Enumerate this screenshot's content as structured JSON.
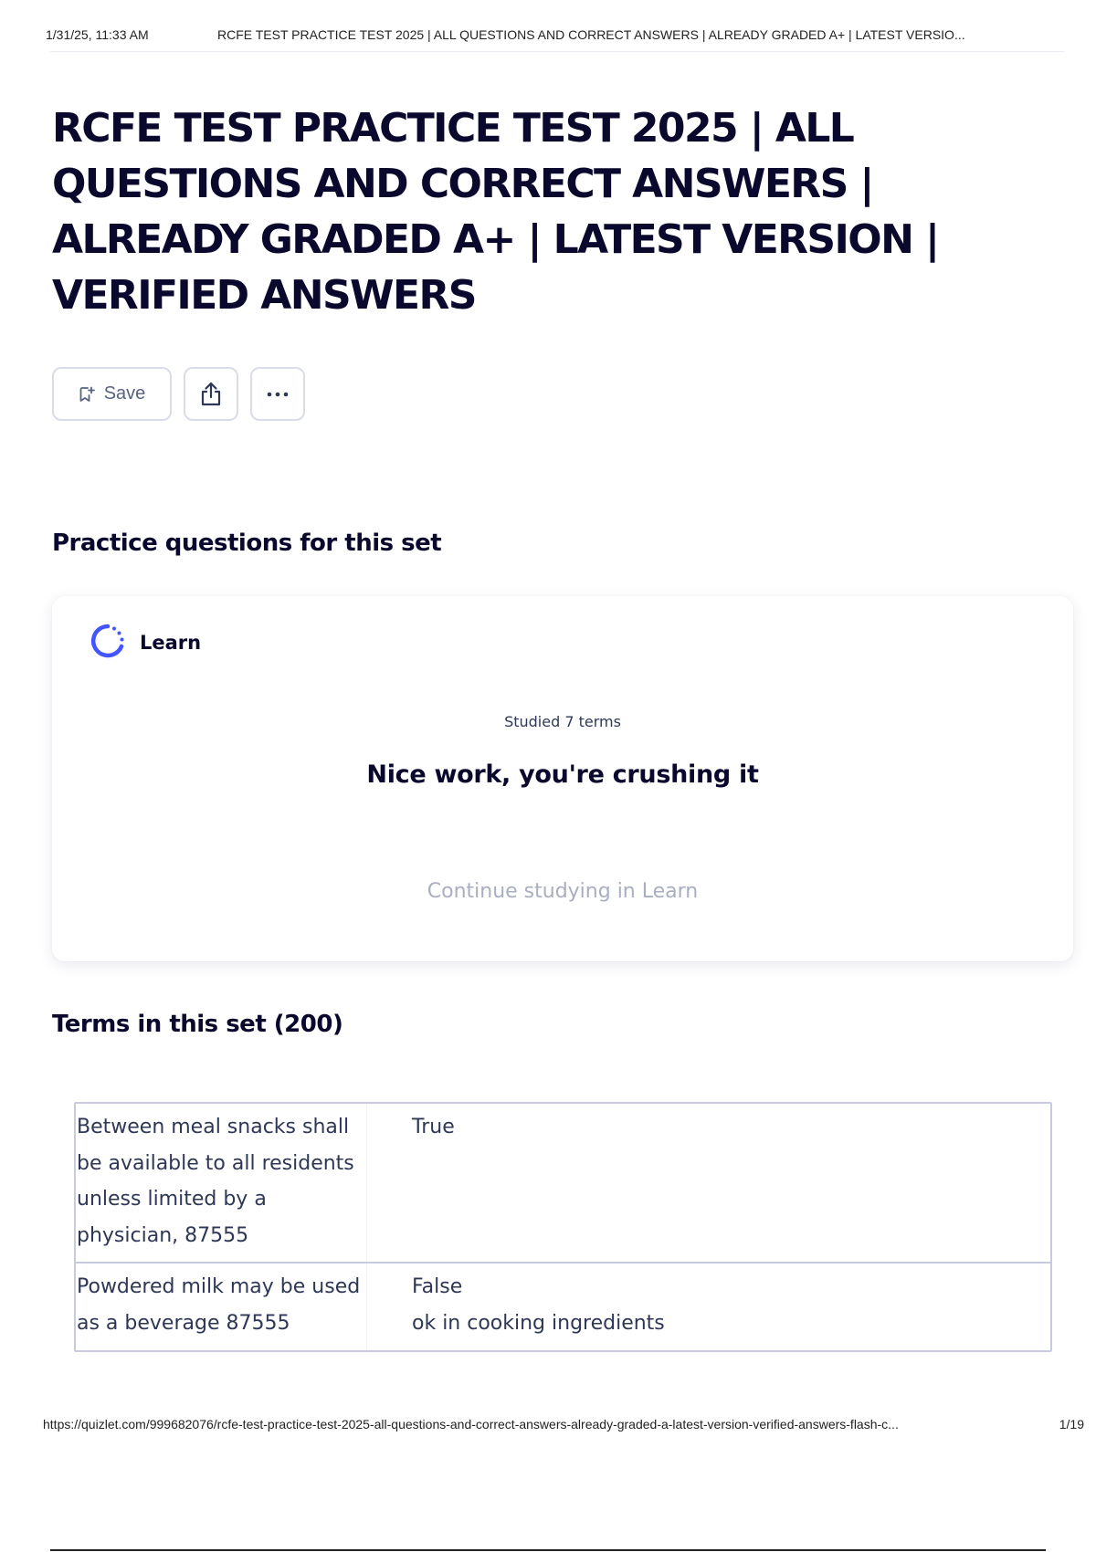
{
  "print_header": {
    "date": "1/31/25, 11:33 AM",
    "title": "RCFE TEST PRACTICE TEST 2025 | ALL QUESTIONS AND CORRECT ANSWERS | ALREADY GRADED A+ | LATEST VERSIO..."
  },
  "page": {
    "title": "RCFE TEST PRACTICE TEST 2025 | ALL QUESTIONS AND CORRECT ANSWERS | ALREADY GRADED A+ | LATEST VERSION | VERIFIED ANSWERS"
  },
  "actions": {
    "save_label": "Save",
    "save_icon": "bookmark-plus-icon",
    "share_icon": "share-icon",
    "more_icon": "more-horizontal-icon"
  },
  "practice": {
    "heading": "Practice questions for this set",
    "mode_icon": "learn-progress-icon",
    "mode_label": "Learn",
    "studied": "Studied 7 terms",
    "message": "Nice work, you're crushing it",
    "continue_label": "Continue studying in Learn"
  },
  "terms": {
    "heading": "Terms in this set (200)",
    "rows": [
      {
        "term": "Between meal snacks shall be available to all residents unless limited by a physician, 87555",
        "definition": "True"
      },
      {
        "term": "Powdered milk may be used as a beverage 87555",
        "definition": "False\nok in cooking ingredients"
      }
    ]
  },
  "print_footer": {
    "url": "https://quizlet.com/999682076/rcfe-test-practice-test-2025-all-questions-and-correct-answers-already-graded-a-latest-version-verified-answers-flash-c...",
    "page": "1/19"
  },
  "colors": {
    "text_primary": "#0a092d",
    "text_secondary": "#586380",
    "muted": "#a9aec0",
    "accent_learn": "#4255ff",
    "border": "#d9dde8"
  }
}
